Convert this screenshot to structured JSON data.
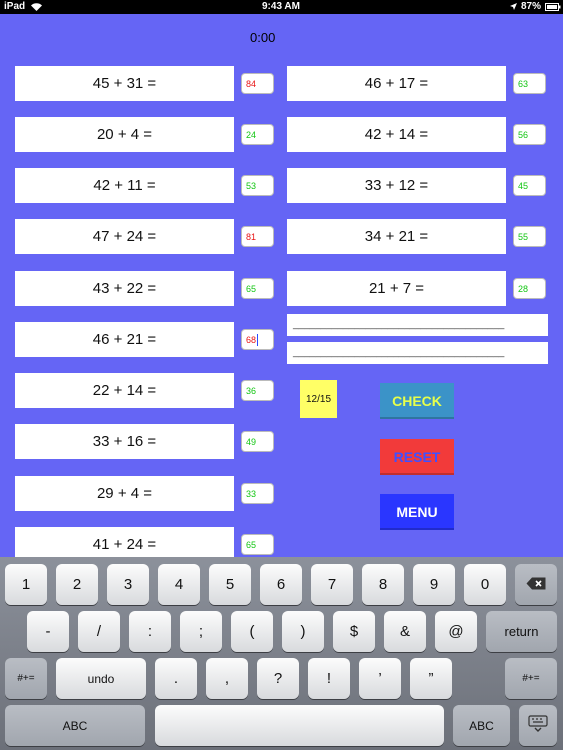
{
  "status_bar": {
    "device": "iPad",
    "time": "9:43 AM",
    "battery": "87%"
  },
  "timer": "0:00",
  "left_problems": [
    {
      "equation": "45 + 31 =",
      "answer": "84",
      "status": "wrong"
    },
    {
      "equation": "20 + 4 =",
      "answer": "24",
      "status": "correct"
    },
    {
      "equation": "42 + 11 =",
      "answer": "53",
      "status": "correct"
    },
    {
      "equation": "47 + 24 =",
      "answer": "81",
      "status": "wrong"
    },
    {
      "equation": "43 + 22 =",
      "answer": "65",
      "status": "correct"
    },
    {
      "equation": "46 + 21 =",
      "answer": "68",
      "status": "wrong"
    },
    {
      "equation": "22 + 14 =",
      "answer": "36",
      "status": "correct"
    },
    {
      "equation": "33 + 16 =",
      "answer": "49",
      "status": "correct"
    },
    {
      "equation": "29 + 4 =",
      "answer": "33",
      "status": "correct"
    },
    {
      "equation": "41 + 24 =",
      "answer": "65",
      "status": "correct"
    }
  ],
  "right_problems": [
    {
      "equation": "46 + 17 =",
      "answer": "63",
      "status": "correct"
    },
    {
      "equation": "42 + 14 =",
      "answer": "56",
      "status": "correct"
    },
    {
      "equation": "33 + 12 =",
      "answer": "45",
      "status": "correct"
    },
    {
      "equation": "34 + 21 =",
      "answer": "55",
      "status": "correct"
    },
    {
      "equation": "21 + 7 =",
      "answer": "28",
      "status": "correct"
    }
  ],
  "blank_rows": [
    "______________________________________",
    "______________________________________"
  ],
  "score": "12/15",
  "buttons": {
    "check": "CHECK",
    "reset": "RESET",
    "menu": "MENU"
  },
  "keyboard": {
    "row1": [
      "1",
      "2",
      "3",
      "4",
      "5",
      "6",
      "7",
      "8",
      "9",
      "0"
    ],
    "row2": [
      "-",
      "/",
      ":",
      ";",
      "(",
      ")",
      "$",
      "&",
      "@"
    ],
    "row3": [
      ".",
      ",",
      "?",
      "!",
      "’",
      "”"
    ],
    "return": "return",
    "shift_left": "#+=",
    "shift_right": "#+=",
    "undo": "undo",
    "abc_left": "ABC",
    "abc_right": "ABC"
  },
  "colors": {
    "background": "#6565f5",
    "correct": "#12c612",
    "wrong": "#e81414",
    "score_bg": "#ffff66",
    "check_bg": "#3b93c8",
    "reset_bg": "#f23a3a",
    "menu_bg": "#2a36ff"
  },
  "icons": [
    "wifi-icon",
    "location-arrow-icon",
    "battery-icon",
    "backspace-icon",
    "keyboard-dismiss-icon"
  ]
}
